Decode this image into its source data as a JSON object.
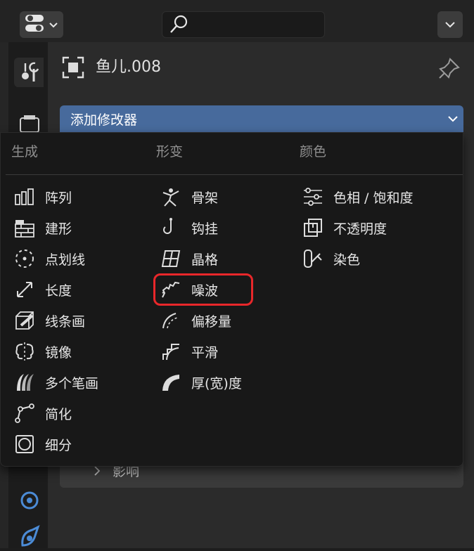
{
  "header": {
    "editor_type_icon": "properties-editor-icon",
    "search": {
      "placeholder": "",
      "value": ""
    },
    "options_icon": "chevron-down-icon"
  },
  "object": {
    "icon": "object-square-icon",
    "name": "鱼儿.008",
    "pin_icon": "pin-icon"
  },
  "add_modifier": {
    "label": "添加修改器"
  },
  "menu": {
    "columns": [
      {
        "heading": "生成",
        "items": [
          {
            "label": "阵列",
            "icon": "array-icon"
          },
          {
            "label": "建形",
            "icon": "build-icon"
          },
          {
            "label": "点划线",
            "icon": "dot-dash-icon"
          },
          {
            "label": "长度",
            "icon": "length-icon"
          },
          {
            "label": "线条画",
            "icon": "line-art-icon"
          },
          {
            "label": "镜像",
            "icon": "mirror-icon"
          },
          {
            "label": "多个笔画",
            "icon": "multiple-strokes-icon"
          },
          {
            "label": "简化",
            "icon": "simplify-icon"
          },
          {
            "label": "细分",
            "icon": "subdivide-icon"
          }
        ]
      },
      {
        "heading": "形变",
        "items": [
          {
            "label": "骨架",
            "icon": "armature-icon"
          },
          {
            "label": "钩挂",
            "icon": "hook-icon"
          },
          {
            "label": "晶格",
            "icon": "lattice-icon"
          },
          {
            "label": "噪波",
            "icon": "noise-icon"
          },
          {
            "label": "偏移量",
            "icon": "offset-icon"
          },
          {
            "label": "平滑",
            "icon": "smooth-icon"
          },
          {
            "label": "厚(宽)度",
            "icon": "thickness-icon"
          }
        ]
      },
      {
        "heading": "颜色",
        "items": [
          {
            "label": "色相 / 饱和度",
            "icon": "hue-saturation-icon"
          },
          {
            "label": "不透明度",
            "icon": "opacity-icon"
          },
          {
            "label": "染色",
            "icon": "tint-icon"
          }
        ]
      }
    ]
  },
  "panel": {
    "influence_label": "影响"
  },
  "colors": {
    "accent_blue": "#476a9c",
    "highlight_red": "#e8272a",
    "menu_bg": "#181818",
    "panel_bg": "#2b2b2b"
  }
}
